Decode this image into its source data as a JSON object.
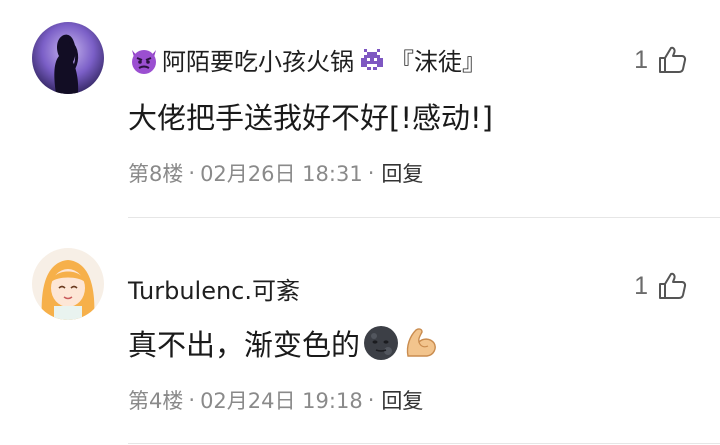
{
  "comments": [
    {
      "username": "阿陌要吃小孩火锅",
      "username_suffix": "『沫徒』",
      "prefix_icon": "angry-devil-emoji",
      "mid_icon": "space-invader-emoji",
      "text": "大佬把手送我好不好[!感动!]",
      "floor": "第8楼",
      "date": "02月26日 18:31",
      "reply_label": "回复",
      "likes": "1"
    },
    {
      "username": "Turbulenc.可紊",
      "text": "真不出，渐变色的",
      "trailing_icons": [
        "new-moon-face-emoji",
        "flexed-biceps-emoji"
      ],
      "floor": "第4楼",
      "date": "02月24日 19:18",
      "reply_label": "回复",
      "likes": "1"
    }
  ],
  "separator": "·",
  "colors": {
    "meta_gray": "#8a8a8a",
    "divider": "#e6e6e6",
    "text": "#1a1a1a"
  }
}
